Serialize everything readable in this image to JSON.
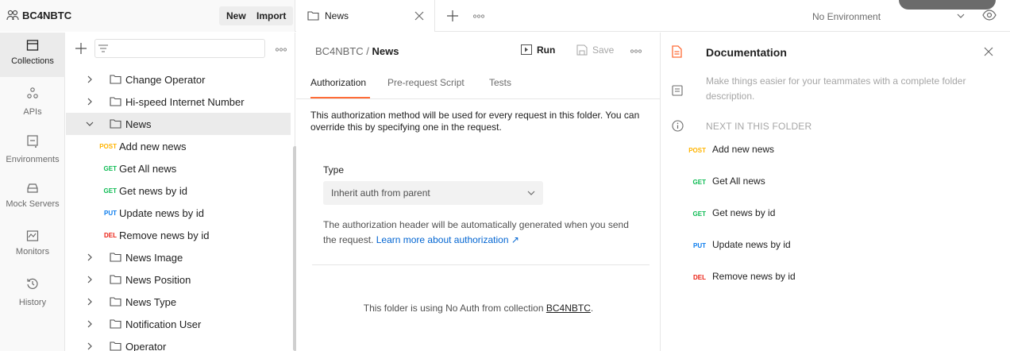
{
  "workspace": {
    "name": "BC4NBTC",
    "new_label": "New",
    "import_label": "Import"
  },
  "tab": {
    "label": "News"
  },
  "environment": {
    "selected": "No Environment"
  },
  "rail": [
    {
      "label": "Collections",
      "icon": "collections-icon"
    },
    {
      "label": "APIs",
      "icon": "apis-icon"
    },
    {
      "label": "Environments",
      "icon": "environments-icon"
    },
    {
      "label": "Mock Servers",
      "icon": "mock-servers-icon"
    },
    {
      "label": "Monitors",
      "icon": "monitors-icon"
    },
    {
      "label": "History",
      "icon": "history-icon"
    }
  ],
  "tree": {
    "folders_before": [
      "Change Operator",
      "Hi-speed Internet Number"
    ],
    "open_folder": "News",
    "requests": [
      {
        "method": "POST",
        "name": "Add new news"
      },
      {
        "method": "GET",
        "name": "Get All news"
      },
      {
        "method": "GET",
        "name": "Get news by id"
      },
      {
        "method": "PUT",
        "name": "Update news by id"
      },
      {
        "method": "DEL",
        "name": "Remove news by id"
      }
    ],
    "folders_after": [
      "News Image",
      "News Position",
      "News Type",
      "Notification User",
      "Operator"
    ]
  },
  "main": {
    "breadcrumb_parent": "BC4NBTC /",
    "breadcrumb_current": "News",
    "run_label": "Run",
    "save_label": "Save",
    "subtabs": [
      "Authorization",
      "Pre-request Script",
      "Tests"
    ],
    "description": "This authorization method will be used for every request in this folder. You can override this by specifying one in the request.",
    "type_label": "Type",
    "type_value": "Inherit auth from parent",
    "auth_note": "The authorization header will be automatically generated when you send the request.",
    "learn_more": "Learn more about authorization ↗",
    "noauth_prefix": "This folder is using No Auth from collection",
    "noauth_link": "BC4NBTC",
    "noauth_suffix": "."
  },
  "docs": {
    "title": "Documentation",
    "description": "Make things easier for your teammates with a complete folder description.",
    "next_title": "NEXT IN THIS FOLDER",
    "requests": [
      {
        "method": "POST",
        "name": "Add new news"
      },
      {
        "method": "GET",
        "name": "Get All news"
      },
      {
        "method": "GET",
        "name": "Get news by id"
      },
      {
        "method": "PUT",
        "name": "Update news by id"
      },
      {
        "method": "DEL",
        "name": "Remove news by id"
      }
    ]
  },
  "colors": {
    "post": "#ffb400",
    "get": "#0cbb52",
    "put": "#097bed",
    "del": "#eb2013",
    "accent": "#ff6c37",
    "link": "#0265d2"
  }
}
